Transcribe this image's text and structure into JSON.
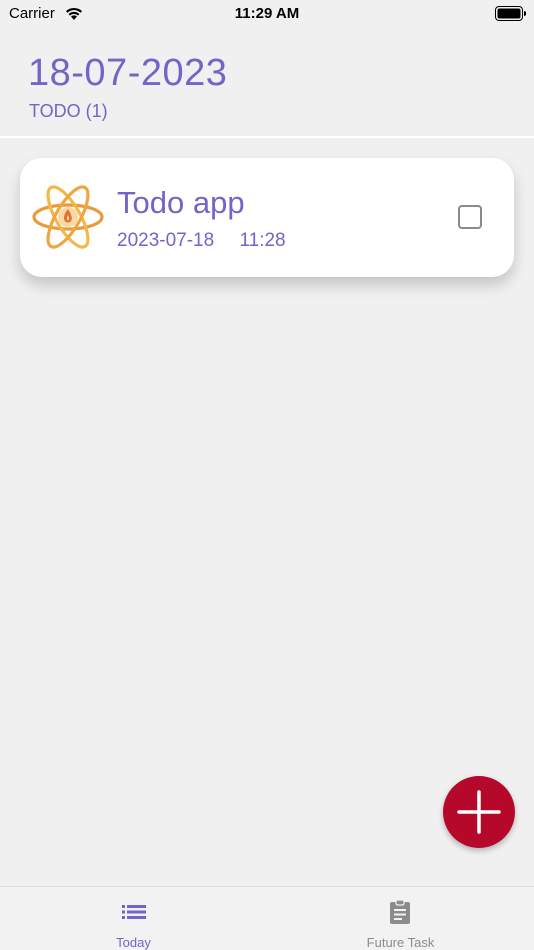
{
  "status_bar": {
    "carrier": "Carrier",
    "time": "11:29 AM"
  },
  "header": {
    "date": "18-07-2023",
    "todo_count": "TODO (1)"
  },
  "tasks": [
    {
      "title": "Todo app",
      "date": "2023-07-18",
      "time": "11:28",
      "checked": false,
      "icon": "atom-logo-icon"
    }
  ],
  "fab": {
    "icon": "plus-icon"
  },
  "bottom_nav": {
    "items": [
      {
        "label": "Today",
        "icon": "list-icon",
        "active": true
      },
      {
        "label": "Future Task",
        "icon": "clipboard-icon",
        "active": false
      }
    ]
  },
  "colors": {
    "accent": "#7265c6",
    "fab": "#b5082a",
    "background": "#f0f0f0",
    "inactive": "#8c8c8c"
  }
}
